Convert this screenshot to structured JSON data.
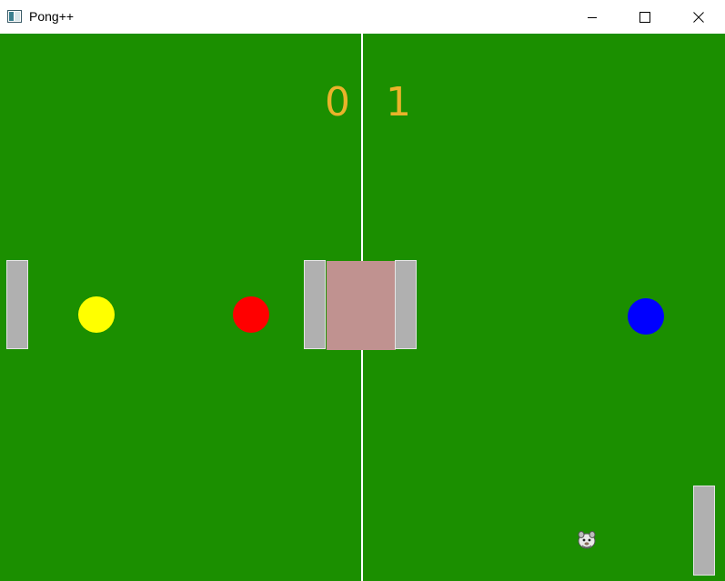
{
  "window": {
    "title": "Pong++",
    "minimize_icon": "minimize-icon",
    "maximize_icon": "maximize-icon",
    "close_icon": "close-icon"
  },
  "game": {
    "score_left": "0",
    "score_right": "1",
    "colors": {
      "field": "#1b8f00",
      "midline": "#ffffff",
      "score": "#e9b32a",
      "paddle": "#b0b0b0",
      "center_block": "#c09290",
      "ball_yellow": "#ffff00",
      "ball_red": "#ff0000",
      "ball_blue": "#0000ff"
    },
    "powerup_icon": "animal-face-icon"
  }
}
